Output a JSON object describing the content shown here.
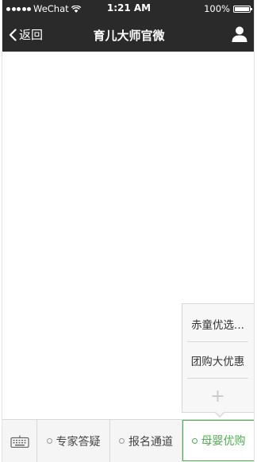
{
  "status_bar": {
    "carrier": "WeChat",
    "time": "1:21 AM",
    "battery": "100%",
    "signal_icon": "signal-dots-icon",
    "wifi_icon": "wifi-icon",
    "battery_icon": "battery-icon"
  },
  "nav": {
    "back_label": "返回",
    "title": "育儿大师官微",
    "profile_icon": "person-icon"
  },
  "popup_menu": {
    "items": [
      {
        "label": "赤童优选..."
      },
      {
        "label": "团购大优惠"
      },
      {
        "label": "+"
      }
    ]
  },
  "bottom_menu": {
    "keyboard_icon": "keyboard-icon",
    "tabs": [
      {
        "label": "专家答疑",
        "active": false
      },
      {
        "label": "报名通道",
        "active": false
      },
      {
        "label": "母婴优购",
        "active": true
      }
    ]
  },
  "colors": {
    "nav_bg": "#2a2a2a",
    "accent": "#4caf50"
  }
}
